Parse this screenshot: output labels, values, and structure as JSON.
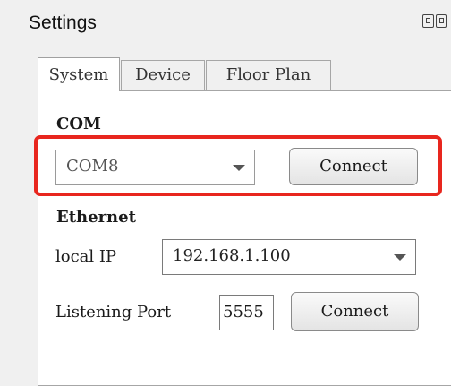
{
  "window": {
    "title": "Settings"
  },
  "tabs": [
    {
      "label": "System",
      "active": true
    },
    {
      "label": "Device",
      "active": false
    },
    {
      "label": "Floor Plan",
      "active": false
    }
  ],
  "com": {
    "heading": "COM",
    "port_value": "COM8",
    "connect_label": "Connect"
  },
  "ethernet": {
    "heading": "Ethernet",
    "local_ip_label": "local IP",
    "local_ip_value": "192.168.1.100",
    "port_label": "Listening Port",
    "port_value": "5555",
    "connect_label": "Connect"
  },
  "colors": {
    "highlight": "#e8261e",
    "panel": "#ffffff",
    "window": "#f0f0f0"
  }
}
